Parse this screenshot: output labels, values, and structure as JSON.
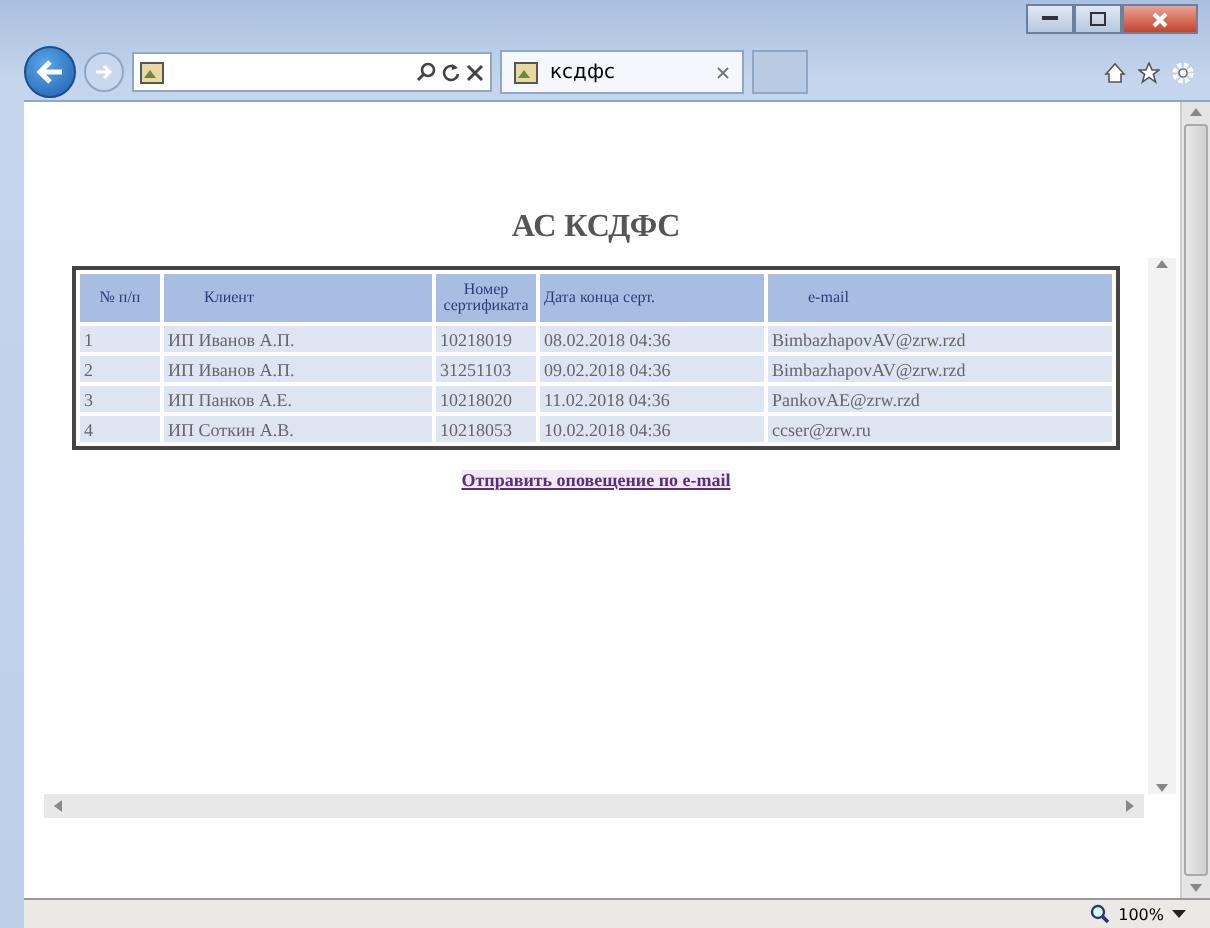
{
  "browser": {
    "tab_title": "ксдфс",
    "zoom": "100%"
  },
  "page": {
    "title": "АС КСДФС",
    "table": {
      "columns": [
        "№ п/п",
        "Клиент",
        "Номер сертификата",
        "Дата конца серт.",
        "e-mail"
      ],
      "rows": [
        [
          "1",
          "ИП Иванов А.П.",
          "10218019",
          "08.02.2018 04:36",
          "BimbazhapovAV@zrw.rzd"
        ],
        [
          "2",
          "ИП Иванов А.П.",
          "31251103",
          "09.02.2018 04:36",
          "BimbazhapovAV@zrw.rzd"
        ],
        [
          "3",
          "ИП Панков А.Е.",
          "10218020",
          "11.02.2018 04:36",
          "PankovAE@zrw.rzd"
        ],
        [
          "4",
          "ИП Соткин А.В.",
          "10218053",
          "10.02.2018 04:36",
          "ccser@zrw.ru"
        ]
      ]
    },
    "link": "Отправить оповещение по e-mail"
  }
}
